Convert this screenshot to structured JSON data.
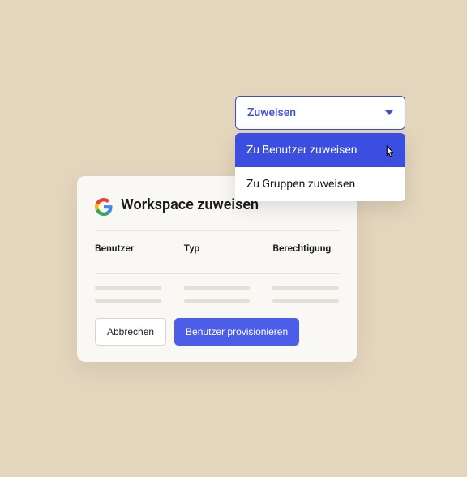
{
  "dropdown": {
    "label": "Zuweisen",
    "items": [
      "Zu Benutzer zuweisen",
      "Zu Gruppen zuweisen"
    ]
  },
  "card": {
    "title": "Workspace zuweisen",
    "columns": {
      "user": "Benutzer",
      "type": "Typ",
      "permission": "Berechtigung"
    },
    "buttons": {
      "cancel": "Abbrechen",
      "provision": "Benutzer provisionieren"
    }
  }
}
